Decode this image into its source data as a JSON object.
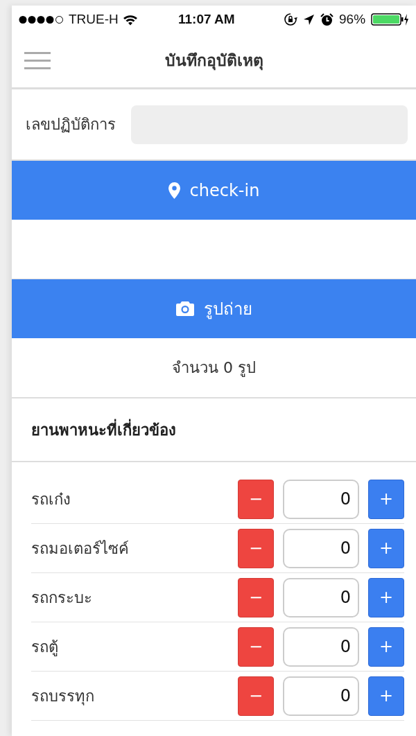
{
  "status_bar": {
    "carrier": "TRUE-H",
    "time": "11:07 AM",
    "battery": "96%"
  },
  "header": {
    "title": "บันทึกอุบัติเหตุ"
  },
  "operation_field": {
    "label": "เลขปฏิบัติการ"
  },
  "checkin_button": {
    "label": "check-in"
  },
  "photo_button": {
    "label": "รูปถ่าย"
  },
  "photo_count": "จำนวน 0 รูป",
  "vehicles": {
    "heading": "ยานพาหนะที่เกี่ยวข้อง",
    "rows": [
      {
        "label": "รถเก๋ง",
        "minus": "−",
        "value": "0",
        "plus": "+"
      },
      {
        "label": "รถมอเตอร์ไซค์",
        "minus": "−",
        "value": "0",
        "plus": "+"
      },
      {
        "label": "รถกระบะ",
        "minus": "−",
        "value": "0",
        "plus": "+"
      },
      {
        "label": "รถตู้",
        "minus": "−",
        "value": "0",
        "plus": "+"
      },
      {
        "label": "รถบรรทุก",
        "minus": "−",
        "value": "0",
        "plus": "+"
      }
    ]
  }
}
